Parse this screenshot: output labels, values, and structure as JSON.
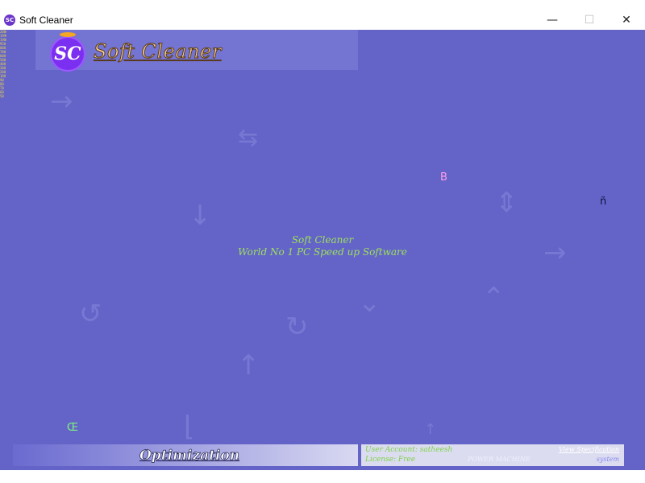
{
  "window": {
    "title": "Soft Cleaner",
    "icon": "sc-logo-icon",
    "controls": {
      "minimize": "—",
      "maximize": "☐",
      "close": "✕"
    }
  },
  "sidebar_ticks": "2000\n1990\n1980\n950\n800\n700\n600\n500\n400\n300\n200\n100\n90\n80\n70\n60\n50\n40\n30\n20\n10\n5",
  "header": {
    "logo_text": "SC",
    "brand": "Soft Cleaner"
  },
  "scattered_letters": {
    "b": "B",
    "n": "ñ",
    "oe": "Œ"
  },
  "splash": {
    "line1": "Soft Cleaner",
    "line2": "World No 1 PC Speed up Software"
  },
  "footer": {
    "optimization": "Optimization",
    "user_account": "User Account: satheesh",
    "license": "License: Free",
    "machine": "POWER MACHINE",
    "view_spec": "View Specification",
    "system": "system"
  },
  "colors": {
    "background": "#6464c8",
    "accent_green": "#9ee05a",
    "brand": "#ffd89a"
  }
}
